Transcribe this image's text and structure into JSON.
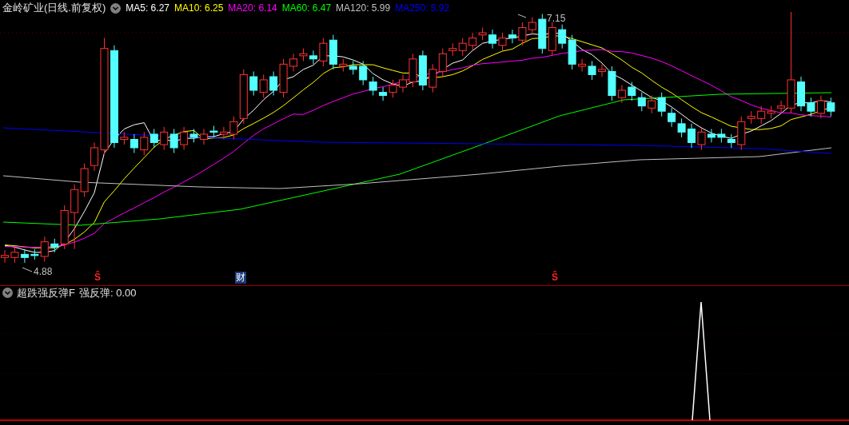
{
  "chart_header": {
    "title": "金岭矿业(日线.前复权)",
    "ma_legend": [
      {
        "label": "MA5: 6.27",
        "color": "#ffffff"
      },
      {
        "label": "MA10: 6.25",
        "color": "#ffff00"
      },
      {
        "label": "MA20: 6.14",
        "color": "#ff00ff"
      },
      {
        "label": "MA60: 6.47",
        "color": "#00ff00"
      },
      {
        "label": "MA120: 5.99",
        "color": "#c0c0c0"
      },
      {
        "label": "MA250: 5.92",
        "color": "#0000ff"
      }
    ]
  },
  "price_annotations": {
    "high": "7.15",
    "low": "4.88"
  },
  "event_markers": [
    {
      "kind": "dividend",
      "text": "Ŝ"
    },
    {
      "kind": "finance",
      "text": "财"
    },
    {
      "kind": "dividend",
      "text": "Ŝ"
    }
  ],
  "indicator_header": {
    "name": "超跌强反弹F",
    "reading": "强反弹: 0.00"
  }
}
